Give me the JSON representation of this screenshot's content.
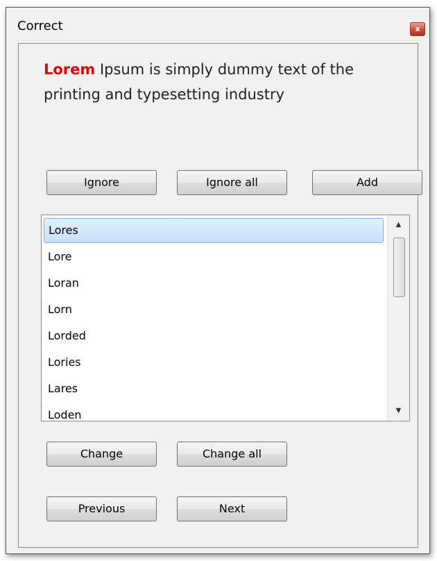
{
  "window": {
    "title": "Correct",
    "close_glyph": "x"
  },
  "message": {
    "highlight": "Lorem",
    "text": " Ipsum is simply dummy text of the printing and typesetting industry"
  },
  "buttons": {
    "ignore": "Ignore",
    "ignore_all": "Ignore all",
    "add": "Add",
    "change": "Change",
    "change_all": "Change all",
    "previous": "Previous",
    "next": "Next"
  },
  "suggestions": {
    "selected": "Lores",
    "items": [
      "Lores",
      "Lore",
      "Loran",
      "Lorn",
      "Lorded",
      "Lories",
      "Lares",
      "Loden"
    ]
  },
  "scrollbar": {
    "up_icon": "▲",
    "down_icon": "▼"
  },
  "colors": {
    "highlight": "#e00000",
    "selection": "#c8e0f8"
  }
}
